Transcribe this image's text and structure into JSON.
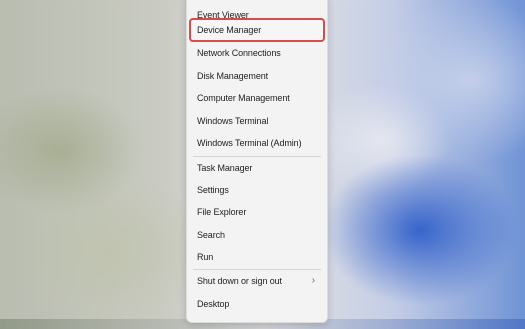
{
  "context_menu": {
    "items": [
      {
        "label": "Event Viewer"
      },
      {
        "label": "Device Manager",
        "highlighted": true
      },
      {
        "label": "Network Connections"
      },
      {
        "label": "Disk Management"
      },
      {
        "label": "Computer Management"
      },
      {
        "label": "Windows Terminal"
      },
      {
        "label": "Windows Terminal (Admin)"
      },
      {
        "label": "Task Manager"
      },
      {
        "label": "Settings"
      },
      {
        "label": "File Explorer"
      },
      {
        "label": "Search"
      },
      {
        "label": "Run"
      },
      {
        "label": "Shut down or sign out",
        "submenu_icon": "chevron-right-icon"
      },
      {
        "label": "Desktop"
      }
    ],
    "highlight_color": "#d94a4a",
    "submenu_glyph": "›"
  }
}
